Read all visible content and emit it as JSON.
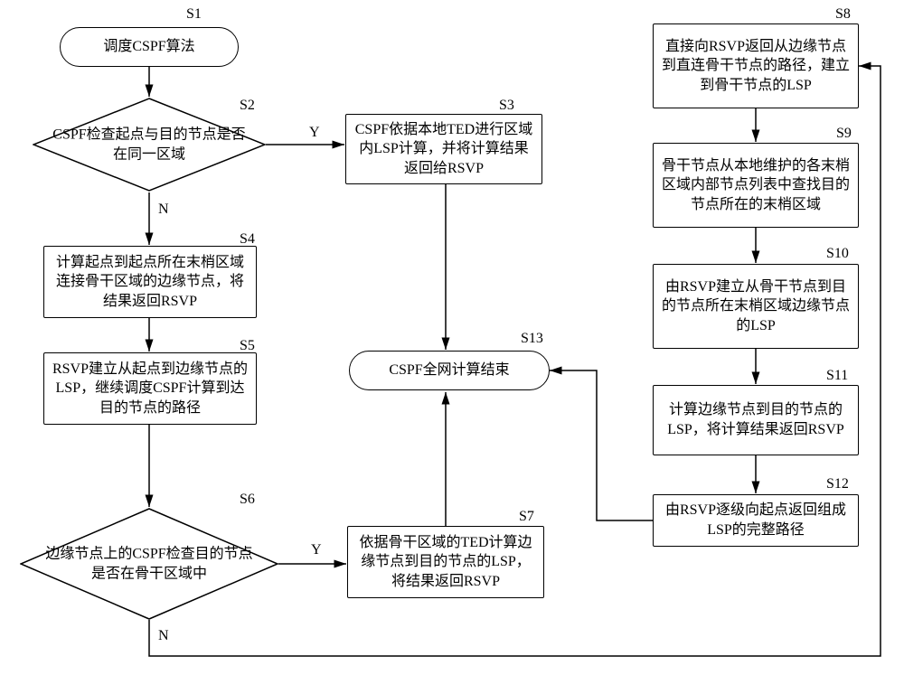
{
  "labels": {
    "s1": "S1",
    "s2": "S2",
    "s3": "S3",
    "s4": "S4",
    "s5": "S5",
    "s6": "S6",
    "s7": "S7",
    "s8": "S8",
    "s9": "S9",
    "s10": "S10",
    "s11": "S11",
    "s12": "S12",
    "s13": "S13"
  },
  "nodes": {
    "n1": "调度CSPF算法",
    "n2": "CSPF检查起点与目的节点是否在同一区域",
    "n3": "CSPF依据本地TED进行区域内LSP计算，并将计算结果返回给RSVP",
    "n4": "计算起点到起点所在末梢区域连接骨干区域的边缘节点，将结果返回RSVP",
    "n5": "RSVP建立从起点到边缘节点的LSP，继续调度CSPF计算到达目的节点的路径",
    "n6": "边缘节点上的CSPF检查目的节点是否在骨干区域中",
    "n7": "依据骨干区域的TED计算边缘节点到目的节点的LSP，将结果返回RSVP",
    "n8": "直接向RSVP返回从边缘节点到直连骨干节点的路径，建立到骨干节点的LSP",
    "n9": "骨干节点从本地维护的各末梢区域内部节点列表中查找目的节点所在的末梢区域",
    "n10": "由RSVP建立从骨干节点到目的节点所在末梢区域边缘节点的LSP",
    "n11": "计算边缘节点到目的节点的LSP，将计算结果返回RSVP",
    "n12": "由RSVP逐级向起点返回组成LSP的完整路径",
    "n13": "CSPF全网计算结束"
  },
  "edges": {
    "y1": "Y",
    "n_1": "N",
    "y2": "Y",
    "n_2": "N"
  }
}
